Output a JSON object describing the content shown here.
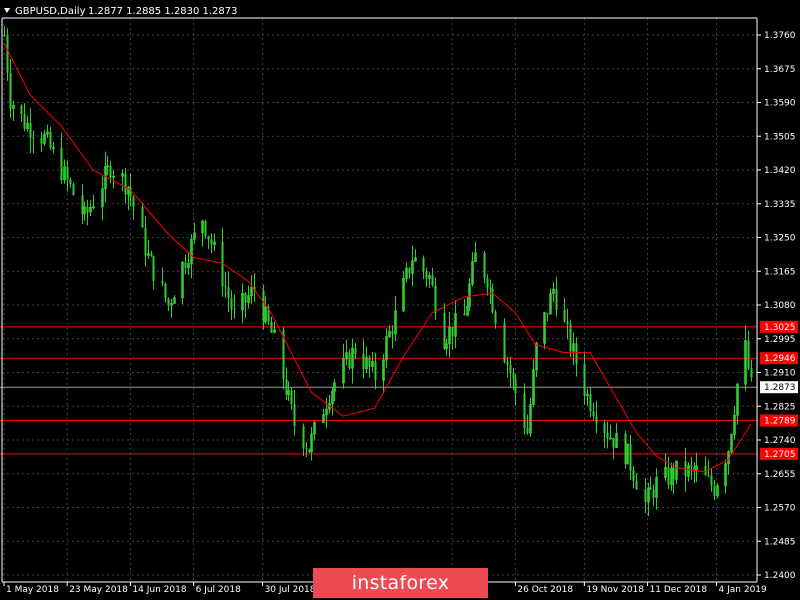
{
  "header": {
    "symbol": "GBPUSD,Daily",
    "ohlc": "1.2877 1.2885 1.2830 1.2873"
  },
  "brand": {
    "logo_text": "instaforex"
  },
  "colors": {
    "background": "#000000",
    "candle": "#32cd32",
    "ma_line": "#ff0000",
    "level_line": "#ff0000",
    "grid": "#404040",
    "axis": "#ffffff",
    "logo_bg": "#ee4a51"
  },
  "chart_data": {
    "type": "line",
    "series_kind": "candlestick-daily",
    "x_range": [
      "2018-05-01",
      "2019-01-16"
    ],
    "ylim": [
      1.24,
      1.38
    ],
    "grid": true,
    "y_ticks": [
      "1.3760",
      "1.3675",
      "1.3590",
      "1.3505",
      "1.3420",
      "1.3335",
      "1.3250",
      "1.3165",
      "1.3080",
      "1.2995",
      "1.2910",
      "1.2825",
      "1.2740",
      "1.2655",
      "1.2570",
      "1.2485",
      "1.2400"
    ],
    "x_ticks": [
      {
        "label": "1 May 2018",
        "date": "2018-05-01"
      },
      {
        "label": "23 May 2018",
        "date": "2018-05-23"
      },
      {
        "label": "14 Jun 2018",
        "date": "2018-06-14"
      },
      {
        "label": "6 Jul 2018",
        "date": "2018-07-06"
      },
      {
        "label": "30 Jul 2018",
        "date": "2018-07-30"
      },
      {
        "label": "8",
        "date": "2018-10-04"
      },
      {
        "label": "26 Oct 2018",
        "date": "2018-10-26"
      },
      {
        "label": "19 Nov 2018",
        "date": "2018-11-19"
      },
      {
        "label": "11 Dec 2018",
        "date": "2018-12-11"
      },
      {
        "label": "4 Jan 2019",
        "date": "2019-01-04"
      }
    ],
    "levels": [
      {
        "label": "1.3025",
        "value": 1.3025
      },
      {
        "label": "1.2946",
        "value": 1.2946
      },
      {
        "label": "1.2789",
        "value": 1.2789
      },
      {
        "label": "1.2705",
        "value": 1.2705
      }
    ],
    "current_price": {
      "label": "1.2873",
      "value": 1.2873
    },
    "close_path": [
      {
        "date": "2018-05-01",
        "close": 1.376
      },
      {
        "date": "2018-05-03",
        "close": 1.36
      },
      {
        "date": "2018-05-08",
        "close": 1.354
      },
      {
        "date": "2018-05-15",
        "close": 1.35
      },
      {
        "date": "2018-05-21",
        "close": 1.342
      },
      {
        "date": "2018-05-29",
        "close": 1.33
      },
      {
        "date": "2018-06-07",
        "close": 1.343
      },
      {
        "date": "2018-06-13",
        "close": 1.338
      },
      {
        "date": "2018-06-20",
        "close": 1.32
      },
      {
        "date": "2018-06-27",
        "close": 1.308
      },
      {
        "date": "2018-07-02",
        "close": 1.318
      },
      {
        "date": "2018-07-09",
        "close": 1.33
      },
      {
        "date": "2018-07-16",
        "close": 1.315
      },
      {
        "date": "2018-07-20",
        "close": 1.305
      },
      {
        "date": "2018-07-27",
        "close": 1.312
      },
      {
        "date": "2018-08-03",
        "close": 1.299
      },
      {
        "date": "2018-08-10",
        "close": 1.278
      },
      {
        "date": "2018-08-15",
        "close": 1.272
      },
      {
        "date": "2018-08-22",
        "close": 1.286
      },
      {
        "date": "2018-08-31",
        "close": 1.297
      },
      {
        "date": "2018-09-07",
        "close": 1.29
      },
      {
        "date": "2018-09-14",
        "close": 1.305
      },
      {
        "date": "2018-09-20",
        "close": 1.32
      },
      {
        "date": "2018-09-26",
        "close": 1.315
      },
      {
        "date": "2018-10-01",
        "close": 1.3
      },
      {
        "date": "2018-10-08",
        "close": 1.305
      },
      {
        "date": "2018-10-12",
        "close": 1.32
      },
      {
        "date": "2018-10-16",
        "close": 1.315
      },
      {
        "date": "2018-10-22",
        "close": 1.296
      },
      {
        "date": "2018-10-30",
        "close": 1.276
      },
      {
        "date": "2018-11-02",
        "close": 1.297
      },
      {
        "date": "2018-11-08",
        "close": 1.312
      },
      {
        "date": "2018-11-14",
        "close": 1.298
      },
      {
        "date": "2018-11-20",
        "close": 1.285
      },
      {
        "date": "2018-11-27",
        "close": 1.276
      },
      {
        "date": "2018-12-04",
        "close": 1.27
      },
      {
        "date": "2018-12-10",
        "close": 1.258
      },
      {
        "date": "2018-12-14",
        "close": 1.263
      },
      {
        "date": "2018-12-21",
        "close": 1.266
      },
      {
        "date": "2018-12-28",
        "close": 1.266
      },
      {
        "date": "2019-01-03",
        "close": 1.262
      },
      {
        "date": "2019-01-08",
        "close": 1.272
      },
      {
        "date": "2019-01-11",
        "close": 1.288
      },
      {
        "date": "2019-01-14",
        "close": 1.297
      },
      {
        "date": "2019-01-16",
        "close": 1.2873
      }
    ],
    "ma_path": [
      {
        "date": "2018-05-01",
        "value": 1.374
      },
      {
        "date": "2018-05-10",
        "value": 1.361
      },
      {
        "date": "2018-05-21",
        "value": 1.353
      },
      {
        "date": "2018-06-01",
        "value": 1.342
      },
      {
        "date": "2018-06-14",
        "value": 1.337
      },
      {
        "date": "2018-06-27",
        "value": 1.326
      },
      {
        "date": "2018-07-06",
        "value": 1.32
      },
      {
        "date": "2018-07-16",
        "value": 1.3185
      },
      {
        "date": "2018-07-25",
        "value": 1.314
      },
      {
        "date": "2018-08-02",
        "value": 1.306
      },
      {
        "date": "2018-08-09",
        "value": 1.296
      },
      {
        "date": "2018-08-16",
        "value": 1.286
      },
      {
        "date": "2018-08-27",
        "value": 1.28
      },
      {
        "date": "2018-09-07",
        "value": 1.282
      },
      {
        "date": "2018-09-17",
        "value": 1.295
      },
      {
        "date": "2018-09-27",
        "value": 1.306
      },
      {
        "date": "2018-10-08",
        "value": 1.31
      },
      {
        "date": "2018-10-18",
        "value": 1.311
      },
      {
        "date": "2018-10-26",
        "value": 1.306
      },
      {
        "date": "2018-11-02",
        "value": 1.298
      },
      {
        "date": "2018-11-12",
        "value": 1.296
      },
      {
        "date": "2018-11-21",
        "value": 1.296
      },
      {
        "date": "2018-11-29",
        "value": 1.286
      },
      {
        "date": "2018-12-07",
        "value": 1.276
      },
      {
        "date": "2018-12-14",
        "value": 1.27
      },
      {
        "date": "2018-12-21",
        "value": 1.267
      },
      {
        "date": "2018-12-31",
        "value": 1.266
      },
      {
        "date": "2019-01-08",
        "value": 1.269
      },
      {
        "date": "2019-01-16",
        "value": 1.278
      }
    ]
  }
}
